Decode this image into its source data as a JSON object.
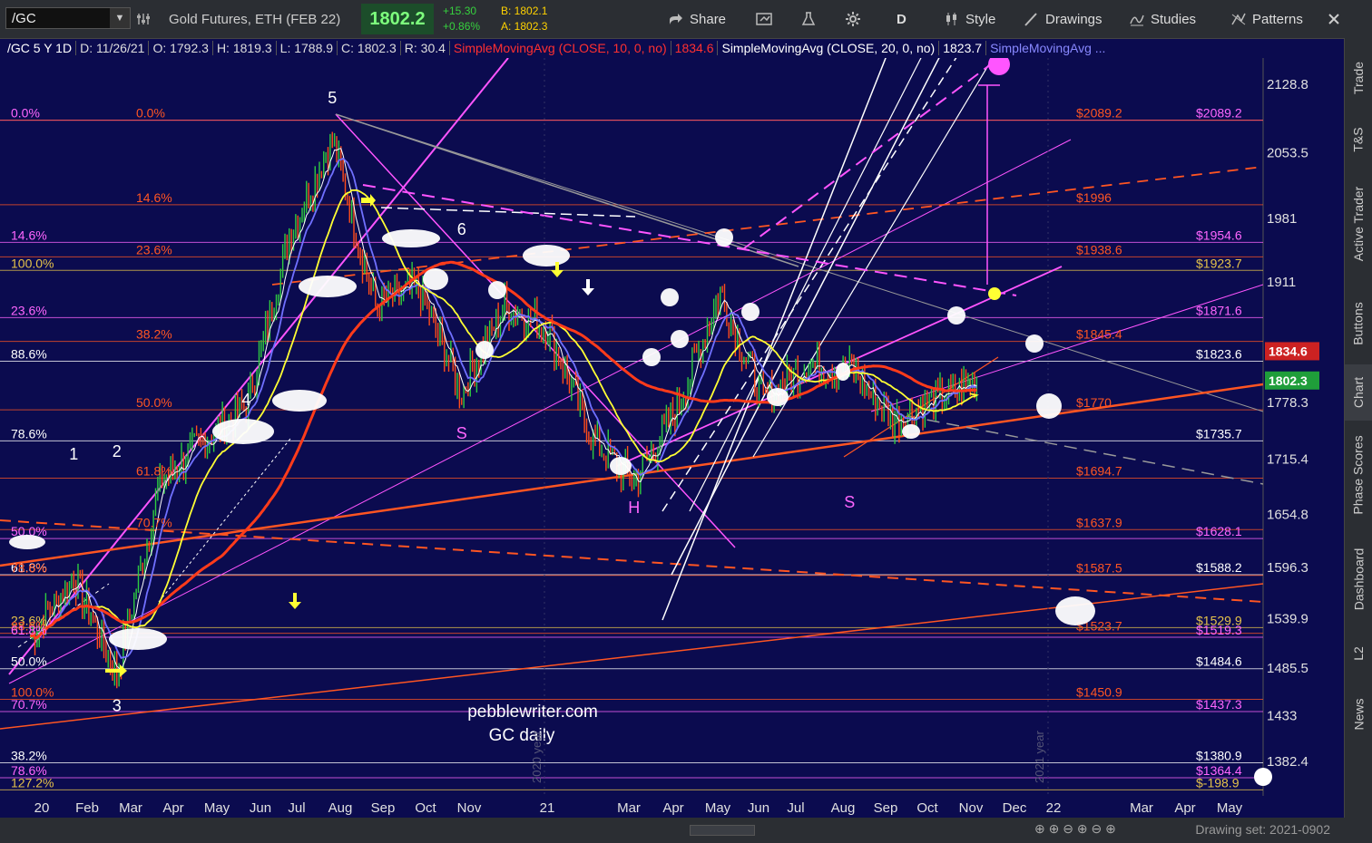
{
  "toolbar": {
    "symbol": "/GC",
    "instrument": "Gold Futures, ETH (FEB 22)",
    "last": "1802.2",
    "change": "+15.30",
    "change_pct": "+0.86%",
    "bid": "B: 1802.1",
    "ask": "A: 1802.3",
    "share": "Share",
    "period": "D",
    "style": "Style",
    "drawings": "Drawings",
    "studies": "Studies",
    "patterns": "Patterns"
  },
  "legend": {
    "symbol": "/GC 5 Y 1D",
    "date": "D: 11/26/21",
    "open": "O: 1792.3",
    "high": "H: 1819.3",
    "low": "L: 1788.9",
    "close": "C: 1802.3",
    "range": "R: 30.4",
    "sma10": "SimpleMovingAvg (CLOSE, 10, 0, no)",
    "sma10_val": "1834.6",
    "sma20": "SimpleMovingAvg (CLOSE, 20, 0, no)",
    "sma20_val": "1823.7",
    "sma3": "SimpleMovingAvg ..."
  },
  "sidebar": [
    "Trade",
    "T&S",
    "Active Trader",
    "Buttons",
    "Chart",
    "Phase Scores",
    "Dashboard",
    "L2",
    "News"
  ],
  "bottom": {
    "drawing_set": "Drawing set: 2021-0902"
  },
  "watermark": {
    "line1": "pebblewriter.com",
    "line2": "GC daily",
    "year2020": "2020 year",
    "year2021": "2021 year"
  },
  "colors": {
    "bg": "#0b0b4f",
    "candle_up": "#2ecc40",
    "candle_down": "#ff4d1a",
    "sma10": "#ffffff",
    "sma20": "#7070ff",
    "sma50": "#ffff33",
    "sma200": "#ff3b1a",
    "magenta": "#ff55ff",
    "orange": "#ff5522"
  },
  "chart_data": {
    "type": "line",
    "title": "/GC 5 Y 1D",
    "ylim": [
      1330,
      2180
    ],
    "y_ticks": [
      2128.8,
      2053.5,
      1981,
      1911,
      1778.3,
      1715.4,
      1654.8,
      1596.3,
      1539.9,
      1485.5,
      1433,
      1382.4
    ],
    "x_ticks": [
      "20",
      "Feb",
      "Mar",
      "Apr",
      "May",
      "Jun",
      "Jul",
      "Aug",
      "Sep",
      "Oct",
      "Nov",
      "21",
      "Mar",
      "Apr",
      "May",
      "Jun",
      "Jul",
      "Aug",
      "Sep",
      "Oct",
      "Nov",
      "Dec",
      "22",
      "Mar",
      "Apr",
      "May"
    ],
    "price_badges": [
      {
        "label": "1834.6",
        "value": 1834.6,
        "color": "#cc2222"
      },
      {
        "label": "1802.3",
        "value": 1802.3,
        "color": "#1f9e3a"
      }
    ],
    "series": [
      {
        "name": "Close",
        "points": [
          [
            "2020-01",
            1520
          ],
          [
            "2020-02",
            1585
          ],
          [
            "2020-03",
            1478
          ],
          [
            "2020-04",
            1690
          ],
          [
            "2020-05",
            1735
          ],
          [
            "2020-06",
            1772
          ],
          [
            "2020-07",
            1960
          ],
          [
            "2020-08",
            2068
          ],
          [
            "2020-09",
            1885
          ],
          [
            "2020-10",
            1905
          ],
          [
            "2020-11",
            1790
          ],
          [
            "2020-12",
            1885
          ],
          [
            "2021-01",
            1860
          ],
          [
            "2021-02",
            1740
          ],
          [
            "2021-03",
            1690
          ],
          [
            "2021-04",
            1770
          ],
          [
            "2021-05",
            1900
          ],
          [
            "2021-06",
            1780
          ],
          [
            "2021-07",
            1820
          ],
          [
            "2021-08",
            1815
          ],
          [
            "2021-09",
            1760
          ],
          [
            "2021-10",
            1780
          ],
          [
            "2021-11",
            1802.3
          ]
        ]
      },
      {
        "name": "SimpleMovingAvg (CLOSE, 10, 0, no)",
        "points": [
          [
            "2021-11",
            1834.6
          ]
        ]
      },
      {
        "name": "SimpleMovingAvg (CLOSE, 20, 0, no)",
        "points": [
          [
            "2021-11",
            1823.7
          ]
        ]
      }
    ],
    "fib_labels_left": [
      {
        "text": "0.0%",
        "value": 2089.2,
        "color": "#ff66ff"
      },
      {
        "text": "0.0%",
        "value": 2089.2,
        "color": "#ff5522"
      },
      {
        "text": "14.6%",
        "value": 1996,
        "color": "#ff5522"
      },
      {
        "text": "14.6%",
        "value": 1954.6,
        "color": "#ff66ff"
      },
      {
        "text": "23.6%",
        "value": 1938.6,
        "color": "#ff5522"
      },
      {
        "text": "100.0%",
        "value": 1923.7,
        "color": "#e6c34a"
      },
      {
        "text": "23.6%",
        "value": 1871.6,
        "color": "#ff66ff"
      },
      {
        "text": "38.2%",
        "value": 1845.4,
        "color": "#ff5522"
      },
      {
        "text": "88.6%",
        "value": 1823.6,
        "color": "#ffffff"
      },
      {
        "text": "50.0%",
        "value": 1770,
        "color": "#ff5522"
      },
      {
        "text": "78.6%",
        "value": 1735.7,
        "color": "#ffffff"
      },
      {
        "text": "61.8%",
        "value": 1694.7,
        "color": "#ff5522"
      },
      {
        "text": "70.7%",
        "value": 1637.9,
        "color": "#ff5522"
      },
      {
        "text": "50.0%",
        "value": 1628.1,
        "color": "#ff66ff"
      },
      {
        "text": "61.8%",
        "value": 1588.2,
        "color": "#ffffff"
      },
      {
        "text": "78.6%",
        "value": 1587.5,
        "color": "#ff5522"
      },
      {
        "text": "23.6%",
        "value": 1529.9,
        "color": "#e6c34a"
      },
      {
        "text": "88.6%",
        "value": 1523.7,
        "color": "#ff5522"
      },
      {
        "text": "61.8%",
        "value": 1519.3,
        "color": "#ff66ff"
      },
      {
        "text": "50.0%",
        "value": 1484.6,
        "color": "#ffffff"
      },
      {
        "text": "100.0%",
        "value": 1450.9,
        "color": "#ff5522"
      },
      {
        "text": "70.7%",
        "value": 1437.3,
        "color": "#ff66ff"
      },
      {
        "text": "38.2%",
        "value": 1380.9,
        "color": "#ffffff"
      },
      {
        "text": "78.6%",
        "value": 1364.4,
        "color": "#ff66ff"
      },
      {
        "text": "127.2%",
        "value": 1351,
        "color": "#e6c34a"
      }
    ],
    "price_labels_right": [
      {
        "text": "$2089.2",
        "value": 2089.2,
        "color": "#ff5522",
        "col": "a"
      },
      {
        "text": "$2089.2",
        "value": 2089.2,
        "color": "#ff66ff",
        "col": "b"
      },
      {
        "text": "$1996",
        "value": 1996,
        "color": "#ff5522",
        "col": "a"
      },
      {
        "text": "$1954.6",
        "value": 1954.6,
        "color": "#ff66ff",
        "col": "b"
      },
      {
        "text": "$1938.6",
        "value": 1938.6,
        "color": "#ff5522",
        "col": "a"
      },
      {
        "text": "$1923.7",
        "value": 1923.7,
        "color": "#e6c34a",
        "col": "b"
      },
      {
        "text": "$1871.6",
        "value": 1871.6,
        "color": "#ff66ff",
        "col": "b"
      },
      {
        "text": "$1845.4",
        "value": 1845.4,
        "color": "#ff5522",
        "col": "a"
      },
      {
        "text": "$1823.6",
        "value": 1823.6,
        "color": "#ffffff",
        "col": "b"
      },
      {
        "text": "$1770",
        "value": 1770,
        "color": "#ff5522",
        "col": "a"
      },
      {
        "text": "$1735.7",
        "value": 1735.7,
        "color": "#ffffff",
        "col": "b"
      },
      {
        "text": "$1694.7",
        "value": 1694.7,
        "color": "#ff5522",
        "col": "a"
      },
      {
        "text": "$1637.9",
        "value": 1637.9,
        "color": "#ff5522",
        "col": "a"
      },
      {
        "text": "$1628.1",
        "value": 1628.1,
        "color": "#ff66ff",
        "col": "b"
      },
      {
        "text": "$1587.5",
        "value": 1587.5,
        "color": "#ff5522",
        "col": "a"
      },
      {
        "text": "$1588.2",
        "value": 1588.2,
        "color": "#ffffff",
        "col": "b"
      },
      {
        "text": "$1529.9",
        "value": 1529.9,
        "color": "#e6c34a",
        "col": "b"
      },
      {
        "text": "$1523.7",
        "value": 1523.7,
        "color": "#ff5522",
        "col": "a"
      },
      {
        "text": "$1519.3",
        "value": 1519.3,
        "color": "#ff66ff",
        "col": "b"
      },
      {
        "text": "$1484.6",
        "value": 1484.6,
        "color": "#ffffff",
        "col": "b"
      },
      {
        "text": "$1450.9",
        "value": 1450.9,
        "color": "#ff5522",
        "col": "a"
      },
      {
        "text": "$1437.3",
        "value": 1437.3,
        "color": "#ff66ff",
        "col": "b"
      },
      {
        "text": "$1380.9",
        "value": 1380.9,
        "color": "#ffffff",
        "col": "b"
      },
      {
        "text": "$1364.4",
        "value": 1364.4,
        "color": "#ff66ff",
        "col": "b"
      },
      {
        "text": "$-198.9",
        "value": 1351,
        "color": "#e6c34a",
        "col": "b"
      }
    ],
    "wave_labels": [
      {
        "text": "1",
        "date": "2020-02",
        "value": 1715
      },
      {
        "text": "2",
        "date": "2020-03",
        "value": 1718
      },
      {
        "text": "3",
        "date": "2020-03",
        "value": 1438
      },
      {
        "text": "4",
        "date": "2020-06",
        "value": 1775
      },
      {
        "text": "5",
        "date": "2020-08",
        "value": 2108
      },
      {
        "text": "6",
        "date": "2020-11",
        "value": 1963
      }
    ],
    "pattern_labels": [
      {
        "text": "S",
        "date": "2020-11",
        "value": 1738
      },
      {
        "text": "H",
        "date": "2021-03",
        "value": 1656
      },
      {
        "text": "S",
        "date": "2021-08",
        "value": 1662
      }
    ]
  }
}
